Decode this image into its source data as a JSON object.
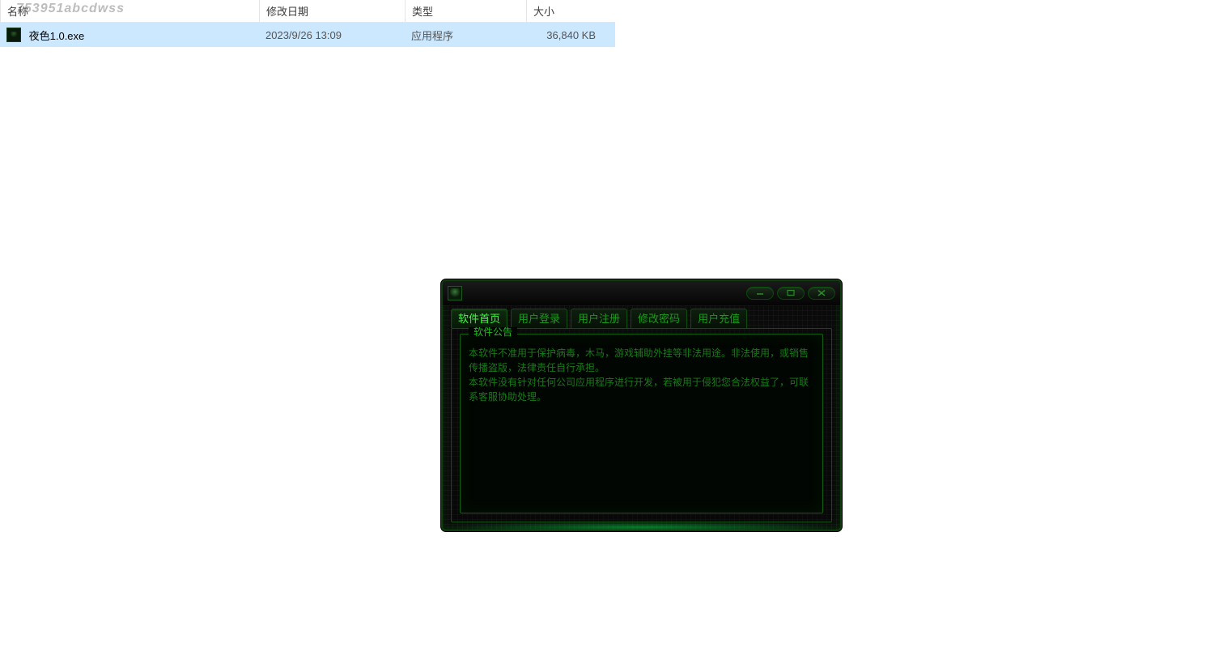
{
  "explorer": {
    "watermark": "753951abcdwss",
    "columns": {
      "name": "名称",
      "date": "修改日期",
      "type": "类型",
      "size": "大小"
    },
    "rows": [
      {
        "name": "夜色1.0.exe",
        "date": "2023/9/26 13:09",
        "type": "应用程序",
        "size": "36,840 KB"
      }
    ]
  },
  "app": {
    "tabs": [
      {
        "label": "软件首页",
        "active": true
      },
      {
        "label": "用户登录",
        "active": false
      },
      {
        "label": "用户注册",
        "active": false
      },
      {
        "label": "修改密码",
        "active": false
      },
      {
        "label": "用户充值",
        "active": false
      }
    ],
    "panel": {
      "legend": "软件公告",
      "notice": "本软件不准用于保护病毒，木马，游戏辅助外挂等非法用途。非法使用，或销售传播盗版，法律责任自行承担。\n本软件没有针对任何公司应用程序进行开发，若被用于侵犯您合法权益了，可联系客服协助处理。"
    }
  }
}
